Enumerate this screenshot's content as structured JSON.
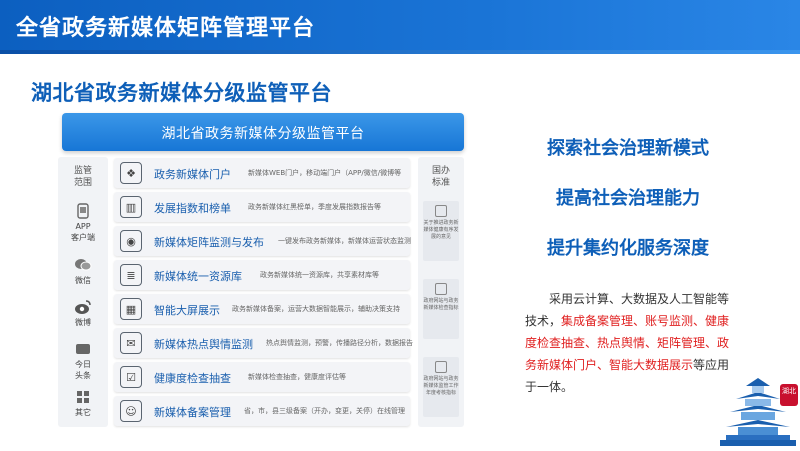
{
  "header": {
    "title": "全省政务新媒体矩阵管理平台"
  },
  "subtitle": "湖北省政务新媒体分级监管平台",
  "panel": {
    "title": "湖北省政务新媒体分级监管平台",
    "left_title_1": "监管",
    "left_title_2": "范围",
    "left_items": [
      {
        "l1": "APP",
        "l2": "客户端",
        "icon": "phone-icon"
      },
      {
        "l1": "微信",
        "l2": "",
        "icon": "wechat-icon"
      },
      {
        "l1": "微博",
        "l2": "",
        "icon": "weibo-icon"
      },
      {
        "l1": "今日",
        "l2": "头条",
        "icon": "toutiao-icon"
      },
      {
        "l1": "其它",
        "l2": "",
        "icon": "grid-icon"
      }
    ],
    "right_title_1": "国办",
    "right_title_2": "标准",
    "right_items": [
      {
        "text": "关于推进政务新媒体健康有序发展的意见"
      },
      {
        "text": "政府网站与政务新媒体检查指标"
      },
      {
        "text": "政府网站与政务新媒体监管工作年度考核指标"
      }
    ],
    "rows": [
      {
        "title": "政务新媒体门户",
        "desc": "新媒体WEB门户，移动端门户（APP/微信/微博等",
        "icon": "apps-icon",
        "glyph": "❖"
      },
      {
        "title": "发展指数和榜单",
        "desc": "政务新媒体红黑榜单，季度发展指数报告等",
        "icon": "bar-chart-icon",
        "glyph": "▥"
      },
      {
        "title": "新媒体矩阵监测与发布",
        "desc": "一键发布政务新媒体，新媒体运营状态监测",
        "icon": "eye-icon",
        "glyph": "◉"
      },
      {
        "title": "新媒体统一资源库",
        "desc": "政务新媒体统一资源库，共享素材库等",
        "icon": "layers-icon",
        "glyph": "≣"
      },
      {
        "title": "智能大屏展示",
        "desc": "政务新媒体备案，运营大数据智能展示，辅助决策支持",
        "icon": "screen-icon",
        "glyph": "▦"
      },
      {
        "title": "新媒体热点舆情监测",
        "desc": "热点舆情监测，预警，传播路径分析，数据报告",
        "icon": "chat-icon",
        "glyph": "✉"
      },
      {
        "title": "健康度检查抽查",
        "desc": "新媒体检查抽查，健康度评估等",
        "icon": "checklist-icon",
        "glyph": "☑"
      },
      {
        "title": "新媒体备案管理",
        "desc": "省，市，县三级备案（开办，变更，关停）在线管理",
        "icon": "user-icon",
        "glyph": "☺"
      }
    ]
  },
  "features": [
    "探索社会治理新模式",
    "提高社会治理能力",
    "提升集约化服务深度"
  ],
  "paragraph": {
    "p1": "采用云计算、大数据及人工智能等技术，",
    "p2": "集成备案管理、账号监测、健康度检查抽查、热点舆情、矩阵管理、政务新媒体门户、智能大数据展示",
    "p3": "等应用于一体。"
  },
  "decoration": {
    "stamp": "湖北"
  },
  "colors": {
    "brand_blue": "#0e5fb8",
    "highlight_red": "#e02020"
  }
}
